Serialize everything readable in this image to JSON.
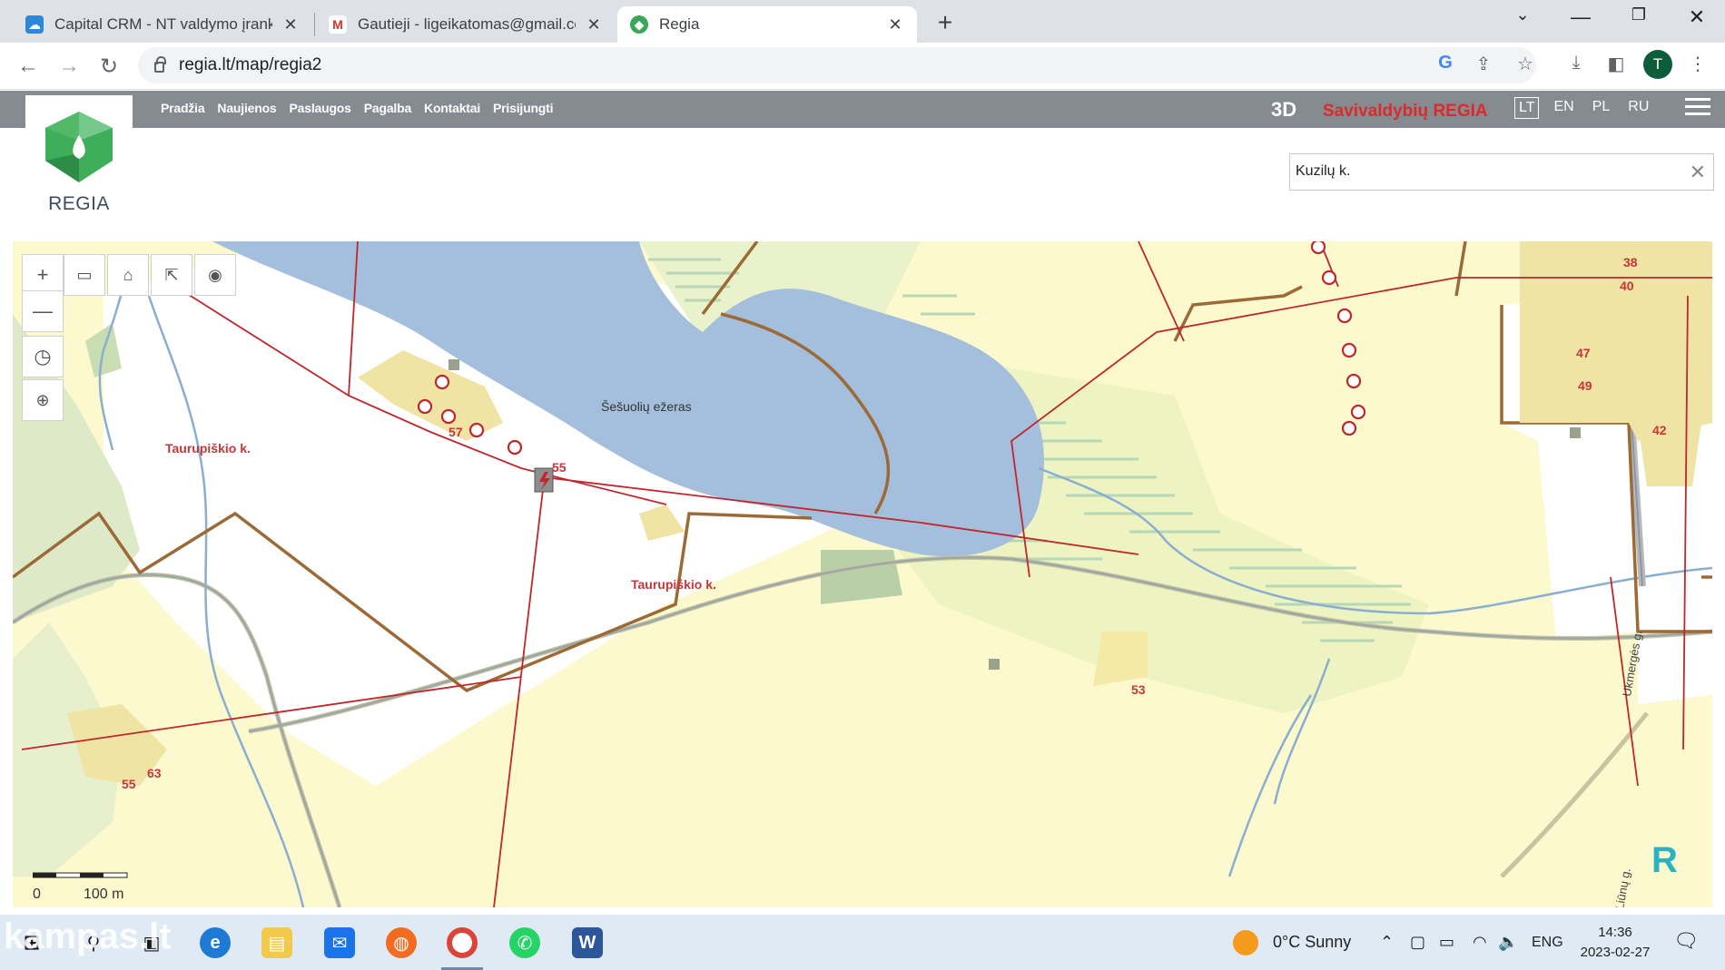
{
  "browser": {
    "tabs": [
      {
        "title": "Capital CRM - NT valdymo įrankis",
        "active": false
      },
      {
        "title": "Gautieji - ligeikatomas@gmail.com",
        "active": false
      },
      {
        "title": "Regia",
        "active": true
      }
    ],
    "url": "regia.lt/map/regia2",
    "profile_initial": "T"
  },
  "site": {
    "logo_text": "REGIA",
    "nav": [
      "Pradžia",
      "Naujienos",
      "Paslaugos",
      "Pagalba",
      "Kontaktai",
      "Prisijungti"
    ],
    "mode_3d": "3D",
    "brand": "Savivaldybių REGIA",
    "languages": [
      "LT",
      "EN",
      "PL",
      "RU"
    ],
    "selected_language": "LT",
    "search_value": "Kuzilų k."
  },
  "map": {
    "lake_name": "Šešuolių ežeras",
    "village_labels": [
      "Taurupiškio k.",
      "Taurupiškio k."
    ],
    "road_label": "Ukmergės g.",
    "road_label_2": "Liūnų g.",
    "parcel_numbers": [
      "57",
      "55",
      "38",
      "40",
      "47",
      "49",
      "42",
      "53",
      "63",
      "55"
    ],
    "scale": {
      "zero": "0",
      "label": "100 m"
    },
    "colors": {
      "land": "#fdf9cf",
      "water": "#a3bfdc",
      "parcel_border": "#9c6a36",
      "power_line": "#c0262c"
    }
  },
  "taskbar": {
    "weather": "0°C  Sunny",
    "lang": "ENG",
    "time": "14:36",
    "date": "2023-02-27",
    "watermark": "kampas.lt"
  }
}
